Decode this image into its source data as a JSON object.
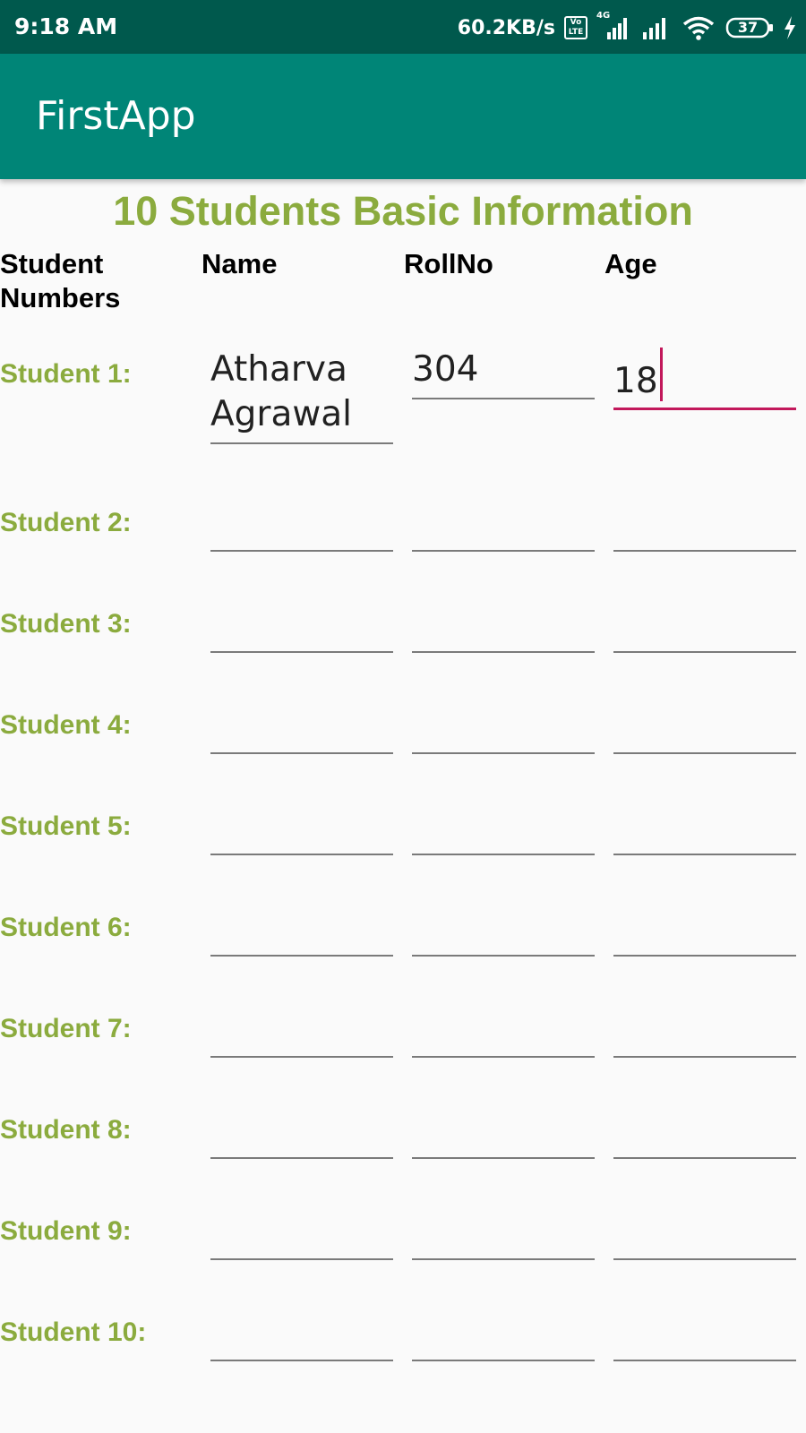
{
  "status_bar": {
    "time": "9:18 AM",
    "net_speed": "60.2KB/s",
    "volte_top": "Vo",
    "volte_bottom": "LTE",
    "network_type": "4G",
    "battery_level": "37",
    "icons": [
      "volte-icon",
      "signal-4g-icon",
      "signal-icon",
      "wifi-icon",
      "battery-icon",
      "charging-icon"
    ]
  },
  "app_bar": {
    "title": "FirstApp"
  },
  "heading": "10 Students Basic Information",
  "columns": {
    "student_numbers": "Student Numbers",
    "name": "Name",
    "rollno": "RollNo",
    "age": "Age"
  },
  "students": [
    {
      "label": "Student 1:",
      "name": "Atharva Agrawal",
      "rollno": "304",
      "age": "18"
    },
    {
      "label": "Student 2:",
      "name": "",
      "rollno": "",
      "age": ""
    },
    {
      "label": "Student 3:",
      "name": "",
      "rollno": "",
      "age": ""
    },
    {
      "label": "Student 4:",
      "name": "",
      "rollno": "",
      "age": ""
    },
    {
      "label": "Student 5:",
      "name": "",
      "rollno": "",
      "age": ""
    },
    {
      "label": "Student 6:",
      "name": "",
      "rollno": "",
      "age": ""
    },
    {
      "label": "Student 7:",
      "name": "",
      "rollno": "",
      "age": ""
    },
    {
      "label": "Student 8:",
      "name": "",
      "rollno": "",
      "age": ""
    },
    {
      "label": "Student 9:",
      "name": "",
      "rollno": "",
      "age": ""
    },
    {
      "label": "Student 10:",
      "name": "",
      "rollno": "",
      "age": ""
    }
  ],
  "colors": {
    "status_bar": "#00594d",
    "app_bar": "#008577",
    "accent_green": "#8bab3e",
    "focus_accent": "#c2185b"
  }
}
